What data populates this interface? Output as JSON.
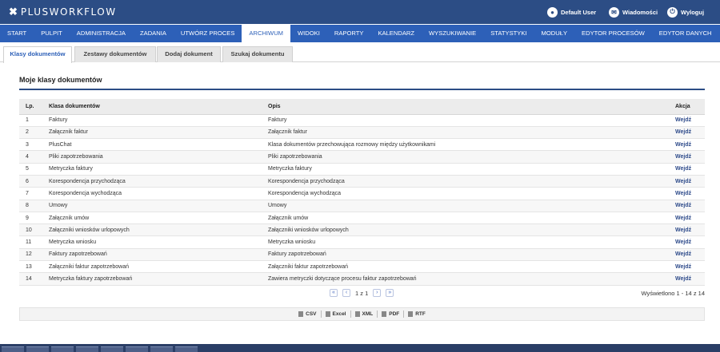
{
  "app": {
    "logo_text": "PLUSWORKFLOW",
    "logo_mark": "✖"
  },
  "topbar": {
    "user_label": "Default User",
    "messages_label": "Wiadomości",
    "logout_label": "Wyloguj"
  },
  "nav": [
    "START",
    "PULPIT",
    "ADMINISTRACJA",
    "ZADANIA",
    "UTWÓRZ PROCES",
    "ARCHIWUM",
    "WIDOKI",
    "RAPORTY",
    "KALENDARZ",
    "WYSZUKIWANIE",
    "STATYSTYKI",
    "MODUŁY",
    "EDYTOR PROCESÓW",
    "EDYTOR DANYCH"
  ],
  "nav_active": 5,
  "subtabs": [
    "Klasy dokumentów",
    "Zestawy dokumentów",
    "Dodaj dokument",
    "Szukaj dokumentu"
  ],
  "section_title": "Moje klasy dokumentów",
  "table": {
    "headers": [
      "Lp.",
      "Klasa dokumentów",
      "Opis",
      "Akcja"
    ],
    "action_label": "Wejdź",
    "rows": [
      [
        "1",
        "Faktury",
        "Faktury"
      ],
      [
        "2",
        "Załącznik faktur",
        "Załącznik faktur"
      ],
      [
        "3",
        "PlusChat",
        "Klasa dokumentów przechowująca rozmowy między użytkownikami"
      ],
      [
        "4",
        "Pliki zapotrzebowania",
        "Pliki zapotrzebowania"
      ],
      [
        "5",
        "Metryczka faktury",
        "Metryczka faktury"
      ],
      [
        "6",
        "Korespondencja przychodząca",
        "Korespondencja przychodząca"
      ],
      [
        "7",
        "Korespondencja wychodząca",
        "Korespondencja wychodząca"
      ],
      [
        "8",
        "Umowy",
        "Umowy"
      ],
      [
        "9",
        "Załącznik umów",
        "Załącznik umów"
      ],
      [
        "10",
        "Załączniki wniosków urlopowych",
        "Załączniki wniosków urlopowych"
      ],
      [
        "11",
        "Metryczka wniosku",
        "Metryczka wniosku"
      ],
      [
        "12",
        "Faktury zapotrzebowań",
        "Faktury zapotrzebowań"
      ],
      [
        "13",
        "Załączniki faktur zapotrzebowań",
        "Załączniki faktur zapotrzebowań"
      ],
      [
        "14",
        "Metryczka faktury zapotrzebowań",
        "Zawiera metryczki dotyczące procesu faktur zapotrzebowań"
      ]
    ]
  },
  "pager": {
    "first": "«",
    "prev": "‹",
    "page_text": "1 z 1",
    "next": "›",
    "last": "»",
    "info": "Wyświetlono 1 - 14 z 14"
  },
  "export": [
    "CSV",
    "Excel",
    "XML",
    "PDF",
    "RTF"
  ],
  "colors": {
    "topbar": "#2c4d85",
    "nav": "#2d60b8",
    "action_link": "#2d4a8a"
  }
}
